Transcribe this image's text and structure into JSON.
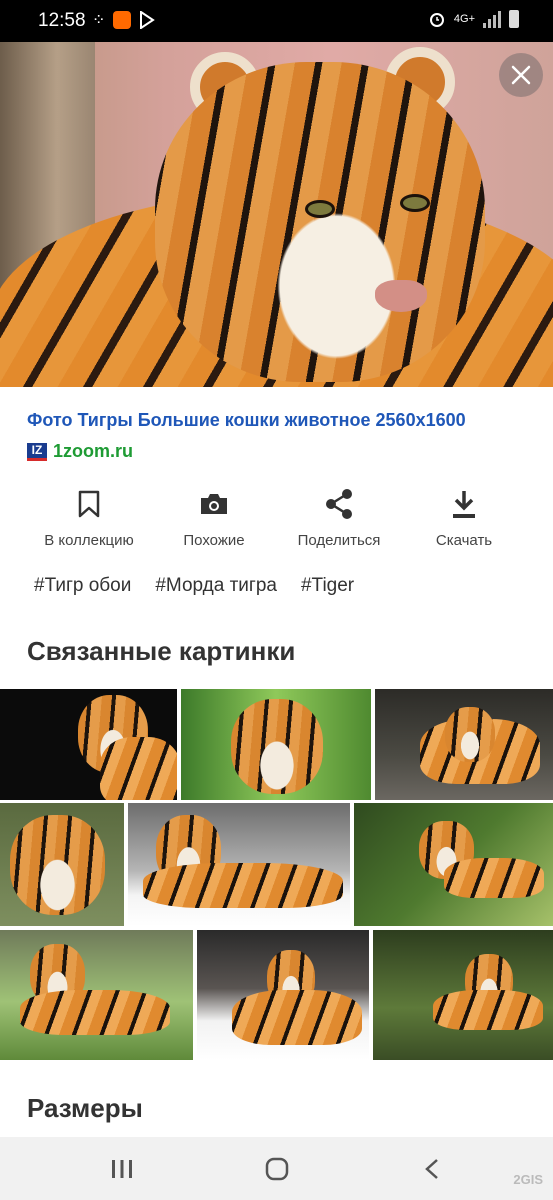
{
  "status_bar": {
    "time": "12:58",
    "network": "4G+"
  },
  "image": {
    "title": "Фото Тигры Большие кошки животное 2560x1600",
    "source": "1zoom.ru",
    "source_logo": "IZ"
  },
  "actions": [
    {
      "label": "В коллекцию",
      "icon": "bookmark-icon"
    },
    {
      "label": "Похожие",
      "icon": "camera-icon"
    },
    {
      "label": "Поделиться",
      "icon": "share-icon"
    },
    {
      "label": "Скачать",
      "icon": "download-icon"
    }
  ],
  "tags": [
    "#Тигр обои",
    "#Морда тигра",
    "#Tiger"
  ],
  "related": {
    "title": "Связанные картинки",
    "count": 9
  },
  "sizes": {
    "title": "Размеры"
  },
  "watermark": "2GIS",
  "colors": {
    "title_link": "#1f57b8",
    "source_link": "#1e9b34",
    "text": "#333333",
    "nav_background": "#f1f1f1"
  }
}
